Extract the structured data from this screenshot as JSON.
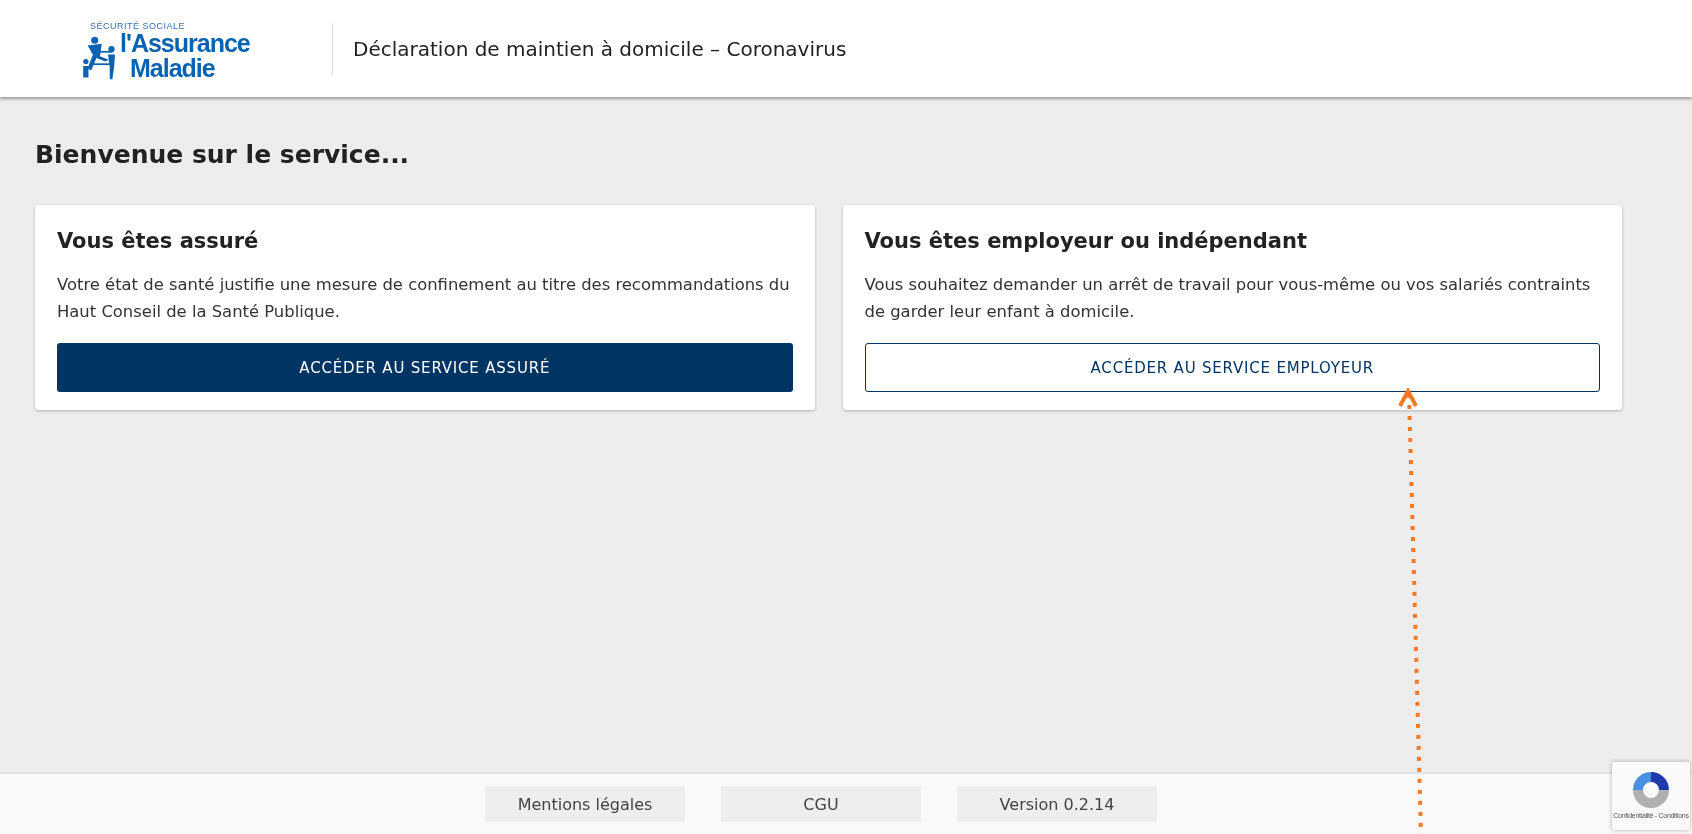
{
  "header": {
    "logo": {
      "arc_text": "SÉCURITÉ SOCIALE",
      "line_1": "l'Assurance",
      "line_2": "Maladie"
    },
    "title": "Déclaration de maintien à domicile – Coronavirus"
  },
  "heading": "Bienvenue sur le service...",
  "cards": [
    {
      "title": "Vous êtes assuré",
      "description": "Votre état de santé justifie une mesure de confinement au titre des recommandations du Haut Conseil de la Santé Publique.",
      "button": {
        "label": "ACCÉDER AU SERVICE ASSURÉ",
        "kind": "primary"
      }
    },
    {
      "title": "Vous êtes employeur ou indépendant",
      "description": "Vous souhaitez demander un arrêt de travail pour vous-même ou vos salariés contraints de garder leur enfant à domicile.",
      "button": {
        "label": "ACCÉDER AU SERVICE EMPLOYEUR",
        "kind": "outline"
      }
    }
  ],
  "footer": {
    "links": [
      "Mentions légales",
      "CGU",
      "Version 0.2.14"
    ]
  },
  "recaptcha": {
    "text": "Confidentialité - Conditions"
  }
}
